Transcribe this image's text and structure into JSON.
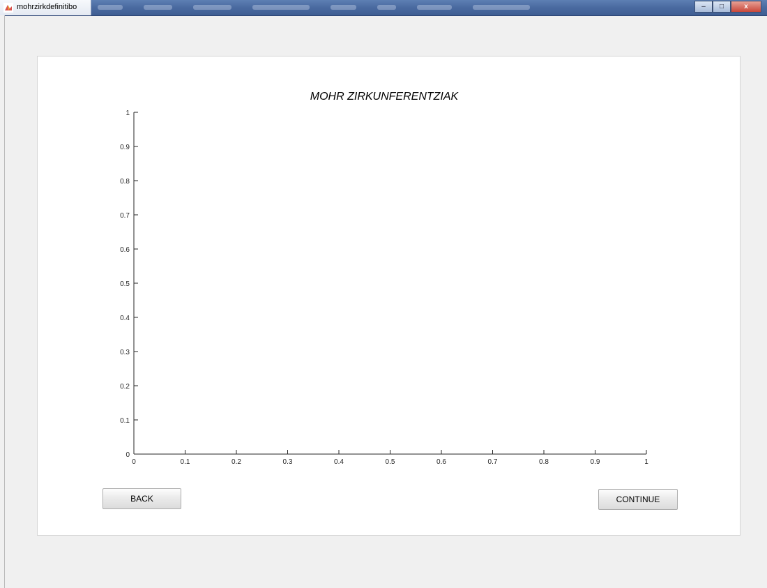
{
  "window": {
    "title": "mohrzirkdefinitibo",
    "controls": {
      "minimize": "–",
      "maximize": "□",
      "close": "x"
    }
  },
  "buttons": {
    "back": "BACK",
    "continue": "CONTINUE"
  },
  "chart_data": {
    "type": "line",
    "title": "MOHR ZIRKUNFERENTZIAK",
    "xlabel": "",
    "ylabel": "",
    "xlim": [
      0,
      1
    ],
    "ylim": [
      0,
      1
    ],
    "x_ticks": [
      "0",
      "0.1",
      "0.2",
      "0.3",
      "0.4",
      "0.5",
      "0.6",
      "0.7",
      "0.8",
      "0.9",
      "1"
    ],
    "y_ticks": [
      "0",
      "0.1",
      "0.2",
      "0.3",
      "0.4",
      "0.5",
      "0.6",
      "0.7",
      "0.8",
      "0.9",
      "1"
    ],
    "series": [],
    "grid": false
  }
}
